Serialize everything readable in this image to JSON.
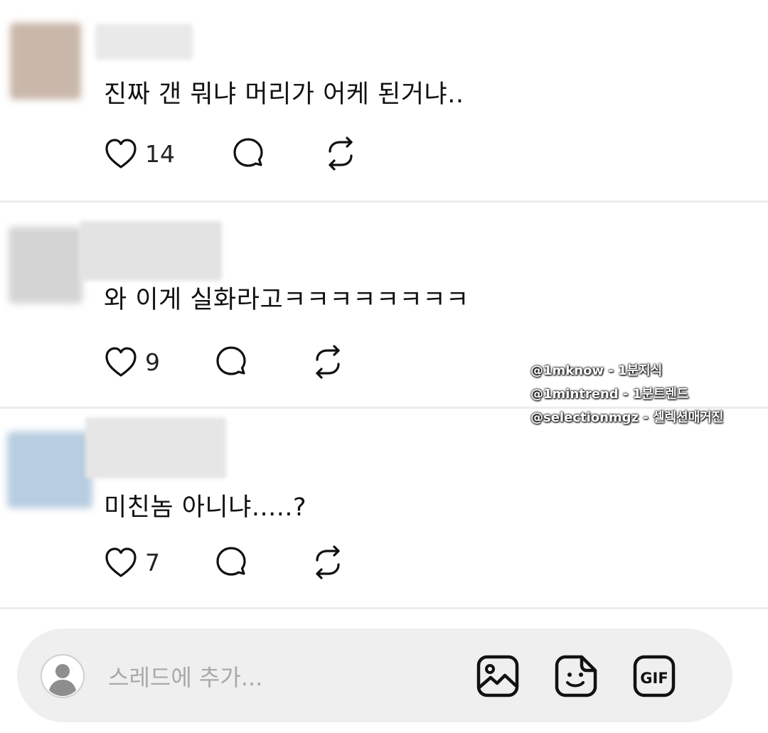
{
  "comments": [
    {
      "text": "진짜 갠 뭐냐 머리가 어케 된거냐..",
      "likes": "14",
      "avatar_color": "#c9b7aa",
      "name_blur_color": "#e9e9e9"
    },
    {
      "text": "와 이게 실화라고ㅋㅋㅋㅋㅋㅋㅋㅋ",
      "likes": "9",
      "avatar_color": "#d4d4d4",
      "name_blur_color": "#e3e3e3"
    },
    {
      "text": "미친놈 아니냐.....?",
      "likes": "7",
      "avatar_color": "#b8cde0",
      "name_blur_color": "#e6e6e6"
    }
  ],
  "icons": {
    "like": "heart-icon",
    "reply": "comment-bubble-icon",
    "repost": "repost-icon"
  },
  "watermark": {
    "line1": "@1mknow - 1분지식",
    "line2": "@1mintrend - 1분트렌드",
    "line3": "@selectionmgz - 셀렉션매거진"
  },
  "composer": {
    "placeholder": "스레드에 추가...",
    "tools": [
      "image-icon",
      "sticker-icon",
      "gif-icon"
    ],
    "gif_label": "GIF"
  }
}
